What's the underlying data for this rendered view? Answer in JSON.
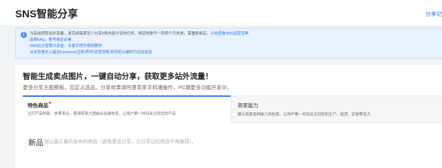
{
  "header": {
    "title": "SNS智能分享",
    "right_link": "分享记录"
  },
  "notice": {
    "icon": "info-icon",
    "line1_text": "为高效获取站外流量，请完成每周至少分享5条内容分享的任务，绑定的账号一到两个月失效，需重新绑定。",
    "line1_link": "点击查看SNS运营宝典",
    "line2_link": "高频FAQ，账号绑定必看",
    "line3_link": "SNS社交营销大讲堂，专家手把手视频教学",
    "line4_link": "点击查看史上最全Facebook注册/养号/运营攻略 如何防止被判为垃圾信息"
  },
  "promo": {
    "title": "智能生成卖点图片，一键自动分享，获取更多站外流量！",
    "desc": "更多分享主题模板，自定义选品，分享效果请阿里卖家手机端操作，PC端更多功能开发中。"
  },
  "tabs": [
    {
      "name": "特色商品",
      "desc": "主打产品的新、热等卖点，使用带张大图结合关键信息，让用户第一时间关注到您的产品",
      "active": true
    },
    {
      "name": "商家能力",
      "desc": "展示商家各种能力的信息，让用户第一时间关注到您的生产、组货、定制等实力",
      "active": false
    }
  ],
  "section": {
    "title": "新品",
    "desc": "默认展示最近发布的商品（避免重复分享，已分享过的商品不再推荐）。"
  }
}
